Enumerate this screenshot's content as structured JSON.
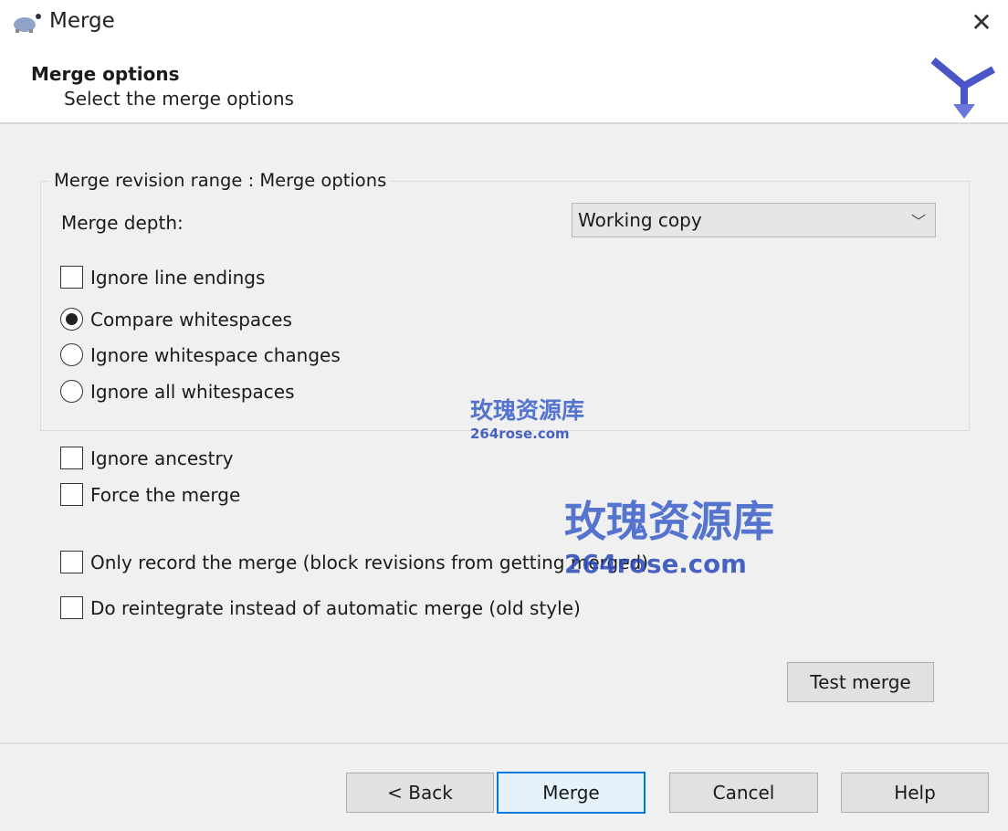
{
  "window": {
    "title": "Merge",
    "close_icon": "close-icon",
    "app_icon": "tortoise-icon"
  },
  "header": {
    "title": "Merge options",
    "subtitle": "Select the merge options",
    "logo": "merge-arrow-logo"
  },
  "group": {
    "label": "Merge revision range : Merge options",
    "depth_label": "Merge depth:",
    "depth_value": "Working copy",
    "ignore_line_endings": {
      "label": "Ignore line endings",
      "checked": false
    },
    "whitespace": [
      {
        "label": "Compare whitespaces",
        "selected": true
      },
      {
        "label": "Ignore whitespace changes",
        "selected": false
      },
      {
        "label": "Ignore all whitespaces",
        "selected": false
      }
    ]
  },
  "options": [
    {
      "label": "Ignore ancestry",
      "checked": false
    },
    {
      "label": "Force the merge",
      "checked": false
    },
    {
      "label": "Only record the merge (block revisions from getting merged)",
      "checked": false
    },
    {
      "label": "Do reintegrate instead of automatic merge (old style)",
      "checked": false
    }
  ],
  "buttons": {
    "test_merge": "Test merge",
    "back": "< Back",
    "merge": "Merge",
    "cancel": "Cancel",
    "help": "Help"
  },
  "watermark": {
    "text": "玫瑰资源库",
    "url": "264rose.com"
  }
}
